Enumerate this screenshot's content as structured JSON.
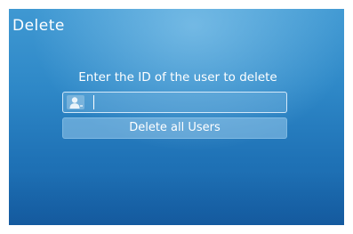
{
  "screen": {
    "title": "Delete",
    "prompt": "Enter the ID of the user to delete",
    "id_field": {
      "value": "",
      "icon": "user-icon"
    },
    "delete_all_label": "Delete all Users"
  },
  "colors": {
    "background_top": "#3f98d2",
    "background_bottom": "#1864a8",
    "text": "#ffffff"
  }
}
